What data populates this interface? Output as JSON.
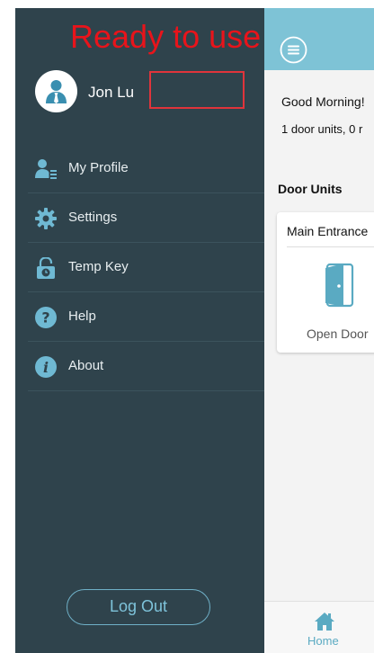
{
  "annotation": {
    "caption": "Ready to use"
  },
  "drawer": {
    "user_name": "Jon Lu",
    "menu": [
      {
        "label": "My Profile",
        "icon": "user-icon"
      },
      {
        "label": "Settings",
        "icon": "gear-icon"
      },
      {
        "label": "Temp Key",
        "icon": "lock-clock-icon"
      },
      {
        "label": "Help",
        "icon": "question-icon"
      },
      {
        "label": "About",
        "icon": "info-icon"
      }
    ],
    "logout_label": "Log Out"
  },
  "main": {
    "greeting": "Good Morning!",
    "summary": "1 door units, 0 r",
    "section_title": "Door Units",
    "card": {
      "title": "Main Entrance",
      "action": "Open Door"
    },
    "bottom_nav": {
      "home_label": "Home"
    }
  },
  "colors": {
    "drawer_bg": "#2f434c",
    "accent": "#7ec3d6",
    "icon_blue": "#5aaac2",
    "annotation_red": "#e8141b"
  }
}
